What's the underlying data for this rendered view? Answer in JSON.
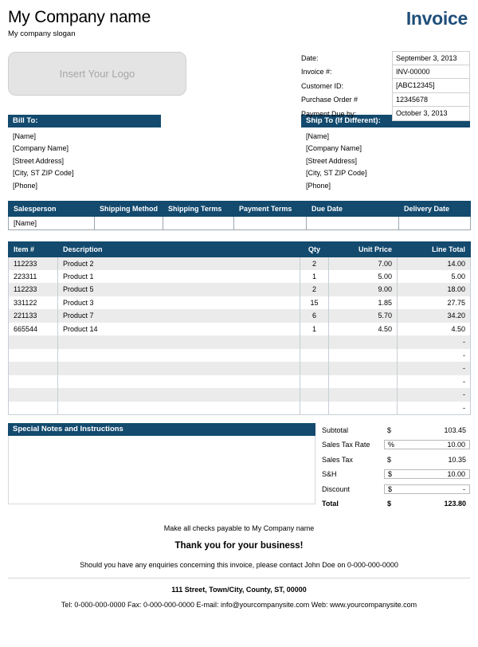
{
  "header": {
    "company_name": "My Company name",
    "company_slogan": "My company slogan",
    "invoice_title": "Invoice",
    "logo_placeholder": "Insert Your Logo"
  },
  "meta": {
    "rows": [
      {
        "label": "Date:",
        "value": "September 3, 2013"
      },
      {
        "label": "Invoice #:",
        "value": "INV-00000"
      },
      {
        "label": "Customer ID:",
        "value": "[ABC12345]"
      },
      {
        "label": "Purchase Order #",
        "value": "12345678"
      },
      {
        "label": "Payment Due by:",
        "value": "October 3, 2013"
      }
    ]
  },
  "bill_to": {
    "title": "Bill To:",
    "lines": [
      "[Name]",
      "[Company Name]",
      "[Street Address]",
      "[City, ST  ZIP Code]",
      "[Phone]"
    ]
  },
  "ship_to": {
    "title": "Ship To (If Different):",
    "lines": [
      "[Name]",
      "[Company Name]",
      "[Street Address]",
      "[City, ST  ZIP Code]",
      "[Phone]"
    ]
  },
  "sales_table": {
    "headers": [
      "Salesperson",
      "Shipping Method",
      "Shipping Terms",
      "Payment Terms",
      "Due Date",
      "Delivery Date"
    ],
    "row": [
      "[Name]",
      "",
      "",
      "",
      "",
      ""
    ]
  },
  "items_table": {
    "headers": [
      "Item #",
      "Description",
      "Qty",
      "Unit Price",
      "Line Total"
    ],
    "rows": [
      {
        "item": "112233",
        "desc": "Product 2",
        "qty": "2",
        "price": "7.00",
        "total": "14.00"
      },
      {
        "item": "223311",
        "desc": "Product 1",
        "qty": "1",
        "price": "5.00",
        "total": "5.00"
      },
      {
        "item": "112233",
        "desc": "Product 5",
        "qty": "2",
        "price": "9.00",
        "total": "18.00"
      },
      {
        "item": "331122",
        "desc": "Product 3",
        "qty": "15",
        "price": "1.85",
        "total": "27.75"
      },
      {
        "item": "221133",
        "desc": "Product 7",
        "qty": "6",
        "price": "5.70",
        "total": "34.20"
      },
      {
        "item": "665544",
        "desc": "Product 14",
        "qty": "1",
        "price": "4.50",
        "total": "4.50"
      },
      {
        "item": "",
        "desc": "",
        "qty": "",
        "price": "",
        "total": "-"
      },
      {
        "item": "",
        "desc": "",
        "qty": "",
        "price": "",
        "total": "-"
      },
      {
        "item": "",
        "desc": "",
        "qty": "",
        "price": "",
        "total": "-"
      },
      {
        "item": "",
        "desc": "",
        "qty": "",
        "price": "",
        "total": "-"
      },
      {
        "item": "",
        "desc": "",
        "qty": "",
        "price": "",
        "total": "-"
      },
      {
        "item": "",
        "desc": "",
        "qty": "",
        "price": "",
        "total": "-"
      }
    ]
  },
  "notes": {
    "title": "Special Notes and Instructions",
    "body": ""
  },
  "totals": {
    "rows": [
      {
        "label": "Subtotal",
        "currency": "$",
        "value": "103.45",
        "boxed": false,
        "grand": false
      },
      {
        "label": "Sales Tax Rate",
        "currency": "%",
        "value": "10.00",
        "boxed": true,
        "grand": false
      },
      {
        "label": "Sales Tax",
        "currency": "$",
        "value": "10.35",
        "boxed": false,
        "grand": false
      },
      {
        "label": "S&H",
        "currency": "$",
        "value": "10.00",
        "boxed": true,
        "grand": false
      },
      {
        "label": "Discount",
        "currency": "$",
        "value": "-",
        "boxed": true,
        "grand": false
      },
      {
        "label": "Total",
        "currency": "$",
        "value": "123.80",
        "boxed": false,
        "grand": true
      }
    ]
  },
  "footer": {
    "payable": "Make all checks payable to My Company name",
    "thanks": "Thank you for your business!",
    "enquiries": "Should you have any enquiries concerning this invoice, please contact John Doe on 0-000-000-0000",
    "address": "111 Street, Town/City, County, ST, 00000",
    "contact": "Tel: 0-000-000-0000 Fax: 0-000-000-0000 E-mail: info@yourcompanysite.com Web: www.yourcompanysite.com"
  },
  "colors": {
    "accent_blue": "#134A6E",
    "title_blue": "#1F4E79",
    "row_alt": "#ebebeb"
  }
}
